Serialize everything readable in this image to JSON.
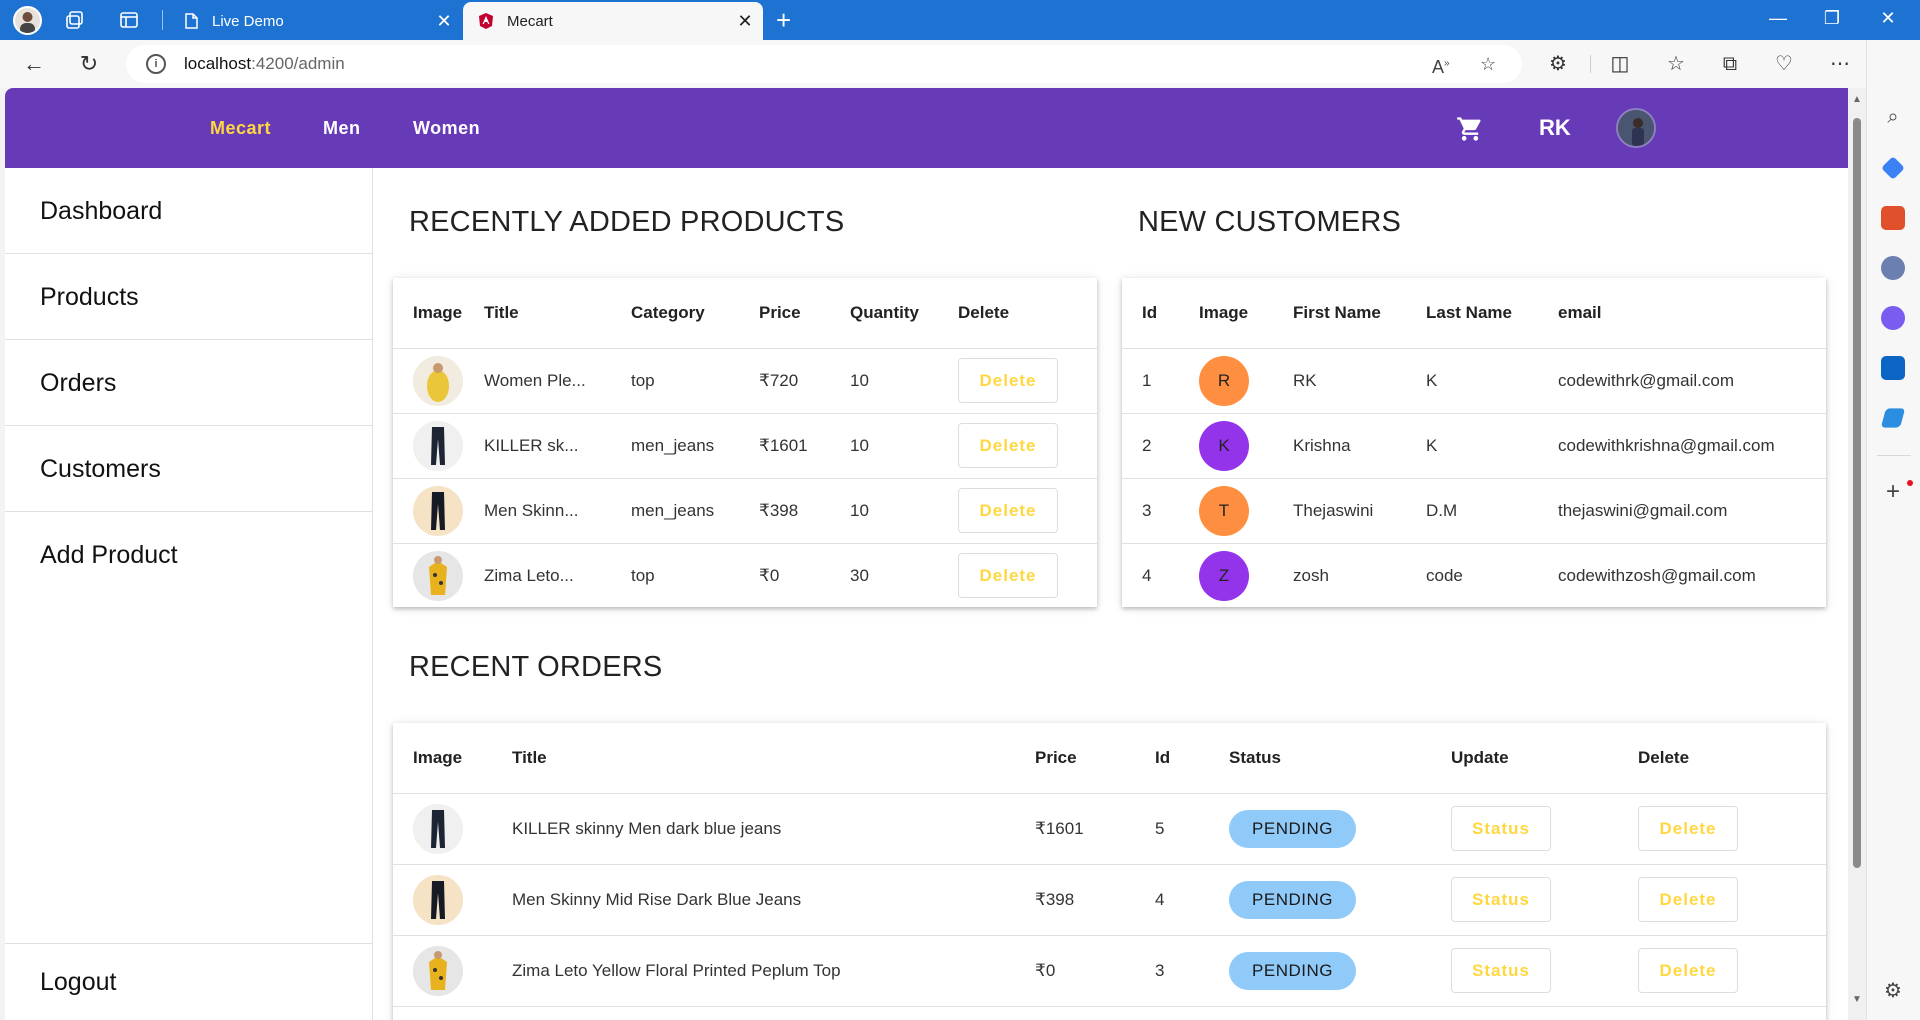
{
  "browser": {
    "tabs": [
      {
        "label": "Live Demo"
      },
      {
        "label": "Mecart"
      }
    ],
    "url_host": "localhost",
    "url_path": ":4200/admin"
  },
  "app": {
    "brand": "Mecart",
    "nav_links": [
      "Men",
      "Women"
    ],
    "user_initials": "RK",
    "accent_color": "#673ab7",
    "brand_color": "#ffd740"
  },
  "sidebar": {
    "items": [
      "Dashboard",
      "Products",
      "Orders",
      "Customers",
      "Add Product"
    ],
    "logout": "Logout"
  },
  "recent_products": {
    "title": "RECENTLY ADDED PRODUCTS",
    "headers": [
      "Image",
      "Title",
      "Category",
      "Price",
      "Quantity",
      "Delete"
    ],
    "rows": [
      {
        "title": "Women Ple...",
        "category": "top",
        "price": "₹720",
        "quantity": "10",
        "delete": "Delete",
        "image": "yellow-top"
      },
      {
        "title": "KILLER sk...",
        "category": "men_jeans",
        "price": "₹1601",
        "quantity": "10",
        "delete": "Delete",
        "image": "dark-jeans"
      },
      {
        "title": "Men Skinn...",
        "category": "men_jeans",
        "price": "₹398",
        "quantity": "10",
        "delete": "Delete",
        "image": "dark-jeans"
      },
      {
        "title": "Zima Leto...",
        "category": "top",
        "price": "₹0",
        "quantity": "30",
        "delete": "Delete",
        "image": "floral-top"
      }
    ]
  },
  "new_customers": {
    "title": "NEW CUSTOMERS",
    "headers": [
      "Id",
      "Image",
      "First Name",
      "Last Name",
      "email"
    ],
    "rows": [
      {
        "id": "1",
        "initial": "R",
        "first": "RK",
        "last": "K",
        "email": "codewithrk@gmail.com",
        "color": "#ff8f40"
      },
      {
        "id": "2",
        "initial": "K",
        "first": "Krishna",
        "last": "K",
        "email": "codewithkrishna@gmail.com",
        "color": "#9333ea"
      },
      {
        "id": "3",
        "initial": "T",
        "first": "Thejaswini",
        "last": "D.M",
        "email": "thejaswini@gmail.com",
        "color": "#ff8f40"
      },
      {
        "id": "4",
        "initial": "Z",
        "first": "zosh",
        "last": "code",
        "email": "codewithzosh@gmail.com",
        "color": "#9333ea"
      }
    ]
  },
  "recent_orders": {
    "title": "RECENT ORDERS",
    "headers": [
      "Image",
      "Title",
      "Price",
      "Id",
      "Status",
      "Update",
      "Delete"
    ],
    "rows": [
      {
        "title": "KILLER skinny Men dark blue jeans",
        "price": "₹1601",
        "id": "5",
        "status": "PENDING",
        "update": "Status",
        "delete": "Delete",
        "image": "dark-jeans"
      },
      {
        "title": "Men Skinny Mid Rise Dark Blue Jeans",
        "price": "₹398",
        "id": "4",
        "status": "PENDING",
        "update": "Status",
        "delete": "Delete",
        "image": "dark-jeans"
      },
      {
        "title": "Zima Leto Yellow Floral Printed Peplum Top",
        "price": "₹0",
        "id": "3",
        "status": "PENDING",
        "update": "Status",
        "delete": "Delete",
        "image": "floral-top"
      }
    ]
  }
}
